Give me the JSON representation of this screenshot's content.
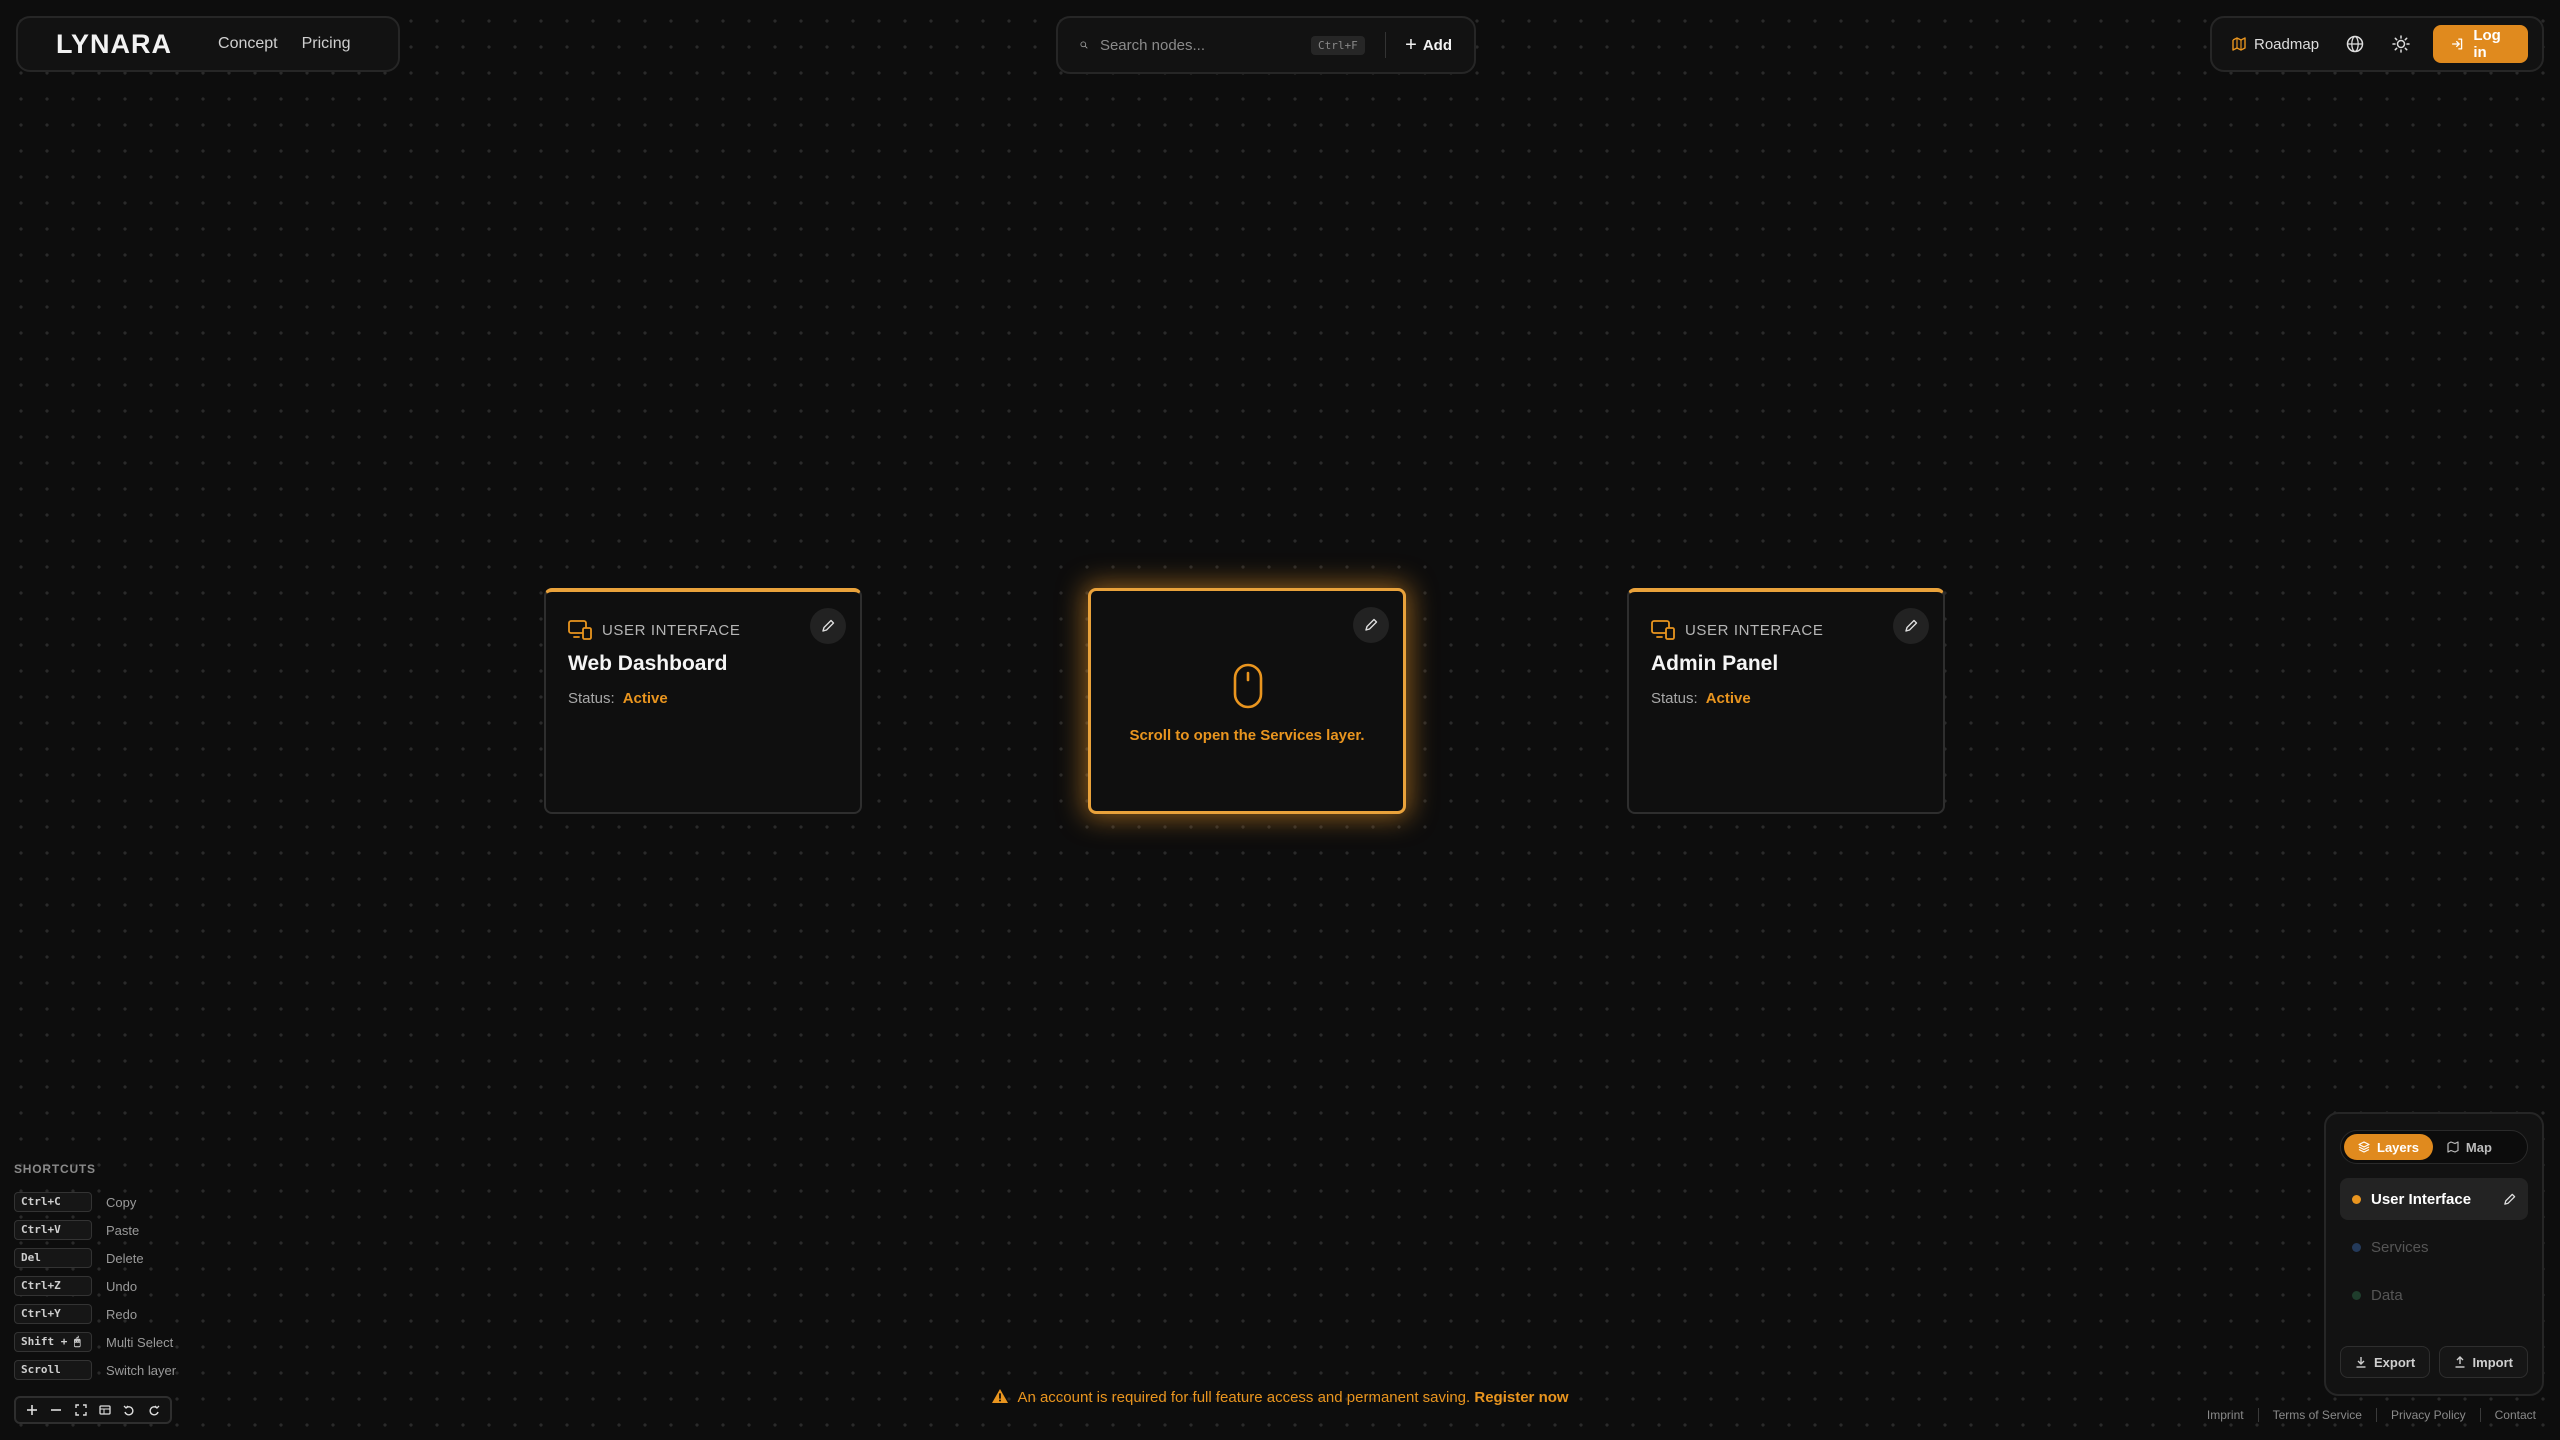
{
  "brand": {
    "name": "LYNARA"
  },
  "nav": {
    "items": [
      "Concept",
      "Pricing"
    ]
  },
  "search": {
    "placeholder": "Search nodes...",
    "shortcut": "Ctrl+F",
    "add_label": "Add"
  },
  "header_right": {
    "roadmap_label": "Roadmap",
    "login_label": "Log in"
  },
  "cards": [
    {
      "type": "USER INTERFACE",
      "title": "Web Dashboard",
      "status_label": "Status:",
      "status_value": "Active"
    },
    {
      "hint": "Scroll to open the Services layer."
    },
    {
      "type": "USER INTERFACE",
      "title": "Admin Panel",
      "status_label": "Status:",
      "status_value": "Active"
    }
  ],
  "shortcuts": {
    "title": "SHORTCUTS",
    "items": [
      {
        "key": "Ctrl+C",
        "label": "Copy"
      },
      {
        "key": "Ctrl+V",
        "label": "Paste"
      },
      {
        "key": "Del",
        "label": "Delete"
      },
      {
        "key": "Ctrl+Z",
        "label": "Undo"
      },
      {
        "key": "Ctrl+Y",
        "label": "Redo"
      },
      {
        "key": "Shift + 🖱",
        "label": "Multi Select"
      },
      {
        "key": "Scroll",
        "label": "Switch layer"
      }
    ]
  },
  "warning": {
    "text": "An account is required for full feature access and permanent saving.",
    "link": "Register now"
  },
  "footer": {
    "links": [
      "Imprint",
      "Terms of Service",
      "Privacy Policy",
      "Contact"
    ]
  },
  "layers_panel": {
    "tabs": {
      "layers": "Layers",
      "map": "Map"
    },
    "layers": [
      {
        "name": "User Interface",
        "color": "#e9951f",
        "active": true
      },
      {
        "name": "Services",
        "color": "#243a5a",
        "active": false
      },
      {
        "name": "Data",
        "color": "#1f3d2c",
        "active": false
      }
    ],
    "export_label": "Export",
    "import_label": "Import"
  },
  "colors": {
    "accent": "#e08a1e",
    "background": "#0d0d0d"
  },
  "icons": {
    "logo": "layers-logo-icon",
    "search": "search-icon",
    "roadmap": "map-icon",
    "language": "globe-icon",
    "theme": "sun-icon",
    "login": "login-icon",
    "card_type": "monitor-devices-icon",
    "edit": "pencil-icon",
    "mouse": "mouse-icon",
    "warning": "warning-triangle-icon"
  }
}
